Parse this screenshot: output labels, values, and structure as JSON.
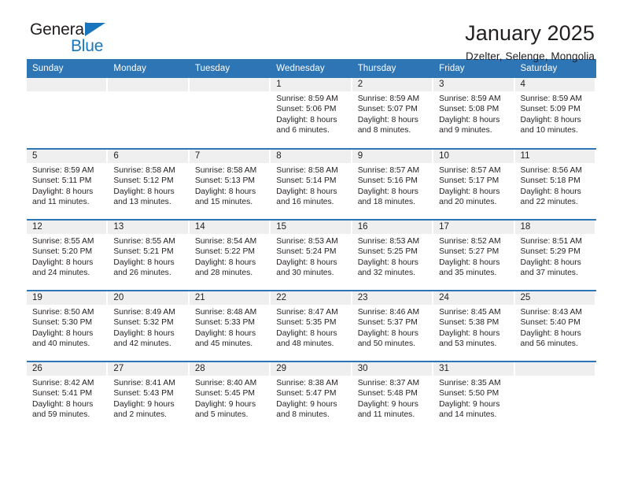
{
  "brand": {
    "name_part1": "General",
    "name_part2": "Blue",
    "triangle_icon": "triangle-icon",
    "accent_color": "#1a76bc"
  },
  "header": {
    "title": "January 2025",
    "location": "Dzelter, Selenge, Mongolia"
  },
  "theme": {
    "header_blue": "#2e75b6",
    "daynum_band": "#efefef",
    "text": "#231f20"
  },
  "calendar": {
    "weekday_headers": [
      "Sunday",
      "Monday",
      "Tuesday",
      "Wednesday",
      "Thursday",
      "Friday",
      "Saturday"
    ],
    "weeks": [
      [
        {
          "day": "",
          "empty": true
        },
        {
          "day": "",
          "empty": true
        },
        {
          "day": "",
          "empty": true
        },
        {
          "day": "1",
          "sunrise": "Sunrise: 8:59 AM",
          "sunset": "Sunset: 5:06 PM",
          "daylight1": "Daylight: 8 hours",
          "daylight2": "and 6 minutes."
        },
        {
          "day": "2",
          "sunrise": "Sunrise: 8:59 AM",
          "sunset": "Sunset: 5:07 PM",
          "daylight1": "Daylight: 8 hours",
          "daylight2": "and 8 minutes."
        },
        {
          "day": "3",
          "sunrise": "Sunrise: 8:59 AM",
          "sunset": "Sunset: 5:08 PM",
          "daylight1": "Daylight: 8 hours",
          "daylight2": "and 9 minutes."
        },
        {
          "day": "4",
          "sunrise": "Sunrise: 8:59 AM",
          "sunset": "Sunset: 5:09 PM",
          "daylight1": "Daylight: 8 hours",
          "daylight2": "and 10 minutes."
        }
      ],
      [
        {
          "day": "5",
          "sunrise": "Sunrise: 8:59 AM",
          "sunset": "Sunset: 5:11 PM",
          "daylight1": "Daylight: 8 hours",
          "daylight2": "and 11 minutes."
        },
        {
          "day": "6",
          "sunrise": "Sunrise: 8:58 AM",
          "sunset": "Sunset: 5:12 PM",
          "daylight1": "Daylight: 8 hours",
          "daylight2": "and 13 minutes."
        },
        {
          "day": "7",
          "sunrise": "Sunrise: 8:58 AM",
          "sunset": "Sunset: 5:13 PM",
          "daylight1": "Daylight: 8 hours",
          "daylight2": "and 15 minutes."
        },
        {
          "day": "8",
          "sunrise": "Sunrise: 8:58 AM",
          "sunset": "Sunset: 5:14 PM",
          "daylight1": "Daylight: 8 hours",
          "daylight2": "and 16 minutes."
        },
        {
          "day": "9",
          "sunrise": "Sunrise: 8:57 AM",
          "sunset": "Sunset: 5:16 PM",
          "daylight1": "Daylight: 8 hours",
          "daylight2": "and 18 minutes."
        },
        {
          "day": "10",
          "sunrise": "Sunrise: 8:57 AM",
          "sunset": "Sunset: 5:17 PM",
          "daylight1": "Daylight: 8 hours",
          "daylight2": "and 20 minutes."
        },
        {
          "day": "11",
          "sunrise": "Sunrise: 8:56 AM",
          "sunset": "Sunset: 5:18 PM",
          "daylight1": "Daylight: 8 hours",
          "daylight2": "and 22 minutes."
        }
      ],
      [
        {
          "day": "12",
          "sunrise": "Sunrise: 8:55 AM",
          "sunset": "Sunset: 5:20 PM",
          "daylight1": "Daylight: 8 hours",
          "daylight2": "and 24 minutes."
        },
        {
          "day": "13",
          "sunrise": "Sunrise: 8:55 AM",
          "sunset": "Sunset: 5:21 PM",
          "daylight1": "Daylight: 8 hours",
          "daylight2": "and 26 minutes."
        },
        {
          "day": "14",
          "sunrise": "Sunrise: 8:54 AM",
          "sunset": "Sunset: 5:22 PM",
          "daylight1": "Daylight: 8 hours",
          "daylight2": "and 28 minutes."
        },
        {
          "day": "15",
          "sunrise": "Sunrise: 8:53 AM",
          "sunset": "Sunset: 5:24 PM",
          "daylight1": "Daylight: 8 hours",
          "daylight2": "and 30 minutes."
        },
        {
          "day": "16",
          "sunrise": "Sunrise: 8:53 AM",
          "sunset": "Sunset: 5:25 PM",
          "daylight1": "Daylight: 8 hours",
          "daylight2": "and 32 minutes."
        },
        {
          "day": "17",
          "sunrise": "Sunrise: 8:52 AM",
          "sunset": "Sunset: 5:27 PM",
          "daylight1": "Daylight: 8 hours",
          "daylight2": "and 35 minutes."
        },
        {
          "day": "18",
          "sunrise": "Sunrise: 8:51 AM",
          "sunset": "Sunset: 5:29 PM",
          "daylight1": "Daylight: 8 hours",
          "daylight2": "and 37 minutes."
        }
      ],
      [
        {
          "day": "19",
          "sunrise": "Sunrise: 8:50 AM",
          "sunset": "Sunset: 5:30 PM",
          "daylight1": "Daylight: 8 hours",
          "daylight2": "and 40 minutes."
        },
        {
          "day": "20",
          "sunrise": "Sunrise: 8:49 AM",
          "sunset": "Sunset: 5:32 PM",
          "daylight1": "Daylight: 8 hours",
          "daylight2": "and 42 minutes."
        },
        {
          "day": "21",
          "sunrise": "Sunrise: 8:48 AM",
          "sunset": "Sunset: 5:33 PM",
          "daylight1": "Daylight: 8 hours",
          "daylight2": "and 45 minutes."
        },
        {
          "day": "22",
          "sunrise": "Sunrise: 8:47 AM",
          "sunset": "Sunset: 5:35 PM",
          "daylight1": "Daylight: 8 hours",
          "daylight2": "and 48 minutes."
        },
        {
          "day": "23",
          "sunrise": "Sunrise: 8:46 AM",
          "sunset": "Sunset: 5:37 PM",
          "daylight1": "Daylight: 8 hours",
          "daylight2": "and 50 minutes."
        },
        {
          "day": "24",
          "sunrise": "Sunrise: 8:45 AM",
          "sunset": "Sunset: 5:38 PM",
          "daylight1": "Daylight: 8 hours",
          "daylight2": "and 53 minutes."
        },
        {
          "day": "25",
          "sunrise": "Sunrise: 8:43 AM",
          "sunset": "Sunset: 5:40 PM",
          "daylight1": "Daylight: 8 hours",
          "daylight2": "and 56 minutes."
        }
      ],
      [
        {
          "day": "26",
          "sunrise": "Sunrise: 8:42 AM",
          "sunset": "Sunset: 5:41 PM",
          "daylight1": "Daylight: 8 hours",
          "daylight2": "and 59 minutes."
        },
        {
          "day": "27",
          "sunrise": "Sunrise: 8:41 AM",
          "sunset": "Sunset: 5:43 PM",
          "daylight1": "Daylight: 9 hours",
          "daylight2": "and 2 minutes."
        },
        {
          "day": "28",
          "sunrise": "Sunrise: 8:40 AM",
          "sunset": "Sunset: 5:45 PM",
          "daylight1": "Daylight: 9 hours",
          "daylight2": "and 5 minutes."
        },
        {
          "day": "29",
          "sunrise": "Sunrise: 8:38 AM",
          "sunset": "Sunset: 5:47 PM",
          "daylight1": "Daylight: 9 hours",
          "daylight2": "and 8 minutes."
        },
        {
          "day": "30",
          "sunrise": "Sunrise: 8:37 AM",
          "sunset": "Sunset: 5:48 PM",
          "daylight1": "Daylight: 9 hours",
          "daylight2": "and 11 minutes."
        },
        {
          "day": "31",
          "sunrise": "Sunrise: 8:35 AM",
          "sunset": "Sunset: 5:50 PM",
          "daylight1": "Daylight: 9 hours",
          "daylight2": "and 14 minutes."
        },
        {
          "day": "",
          "empty": true
        }
      ]
    ]
  }
}
